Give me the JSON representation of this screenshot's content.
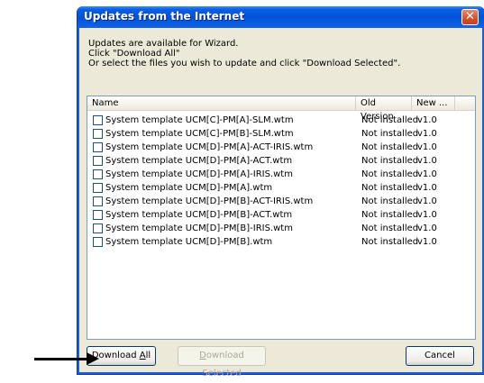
{
  "window": {
    "title": "Updates from the Internet",
    "close_glyph": "✕"
  },
  "instructions": {
    "line1": "Updates are available for Wizard.",
    "line2": "Click \"Download All\"",
    "line3": "Or select the files you wish to update and click \"Download Selected\"."
  },
  "list": {
    "columns": [
      "Name",
      "Old Version",
      "New ..."
    ],
    "rows": [
      {
        "name": "System template UCM[C]-PM[A]-SLM.wtm",
        "old": "Not installed",
        "new": "v1.0",
        "checked": false
      },
      {
        "name": "System template UCM[C]-PM[B]-SLM.wtm",
        "old": "Not installed",
        "new": "v1.0",
        "checked": false
      },
      {
        "name": "System template UCM[D]-PM[A]-ACT-IRIS.wtm",
        "old": "Not installed",
        "new": "v1.0",
        "checked": false
      },
      {
        "name": "System template UCM[D]-PM[A]-ACT.wtm",
        "old": "Not installed",
        "new": "v1.0",
        "checked": false
      },
      {
        "name": "System template UCM[D]-PM[A]-IRIS.wtm",
        "old": "Not installed",
        "new": "v1.0",
        "checked": false
      },
      {
        "name": "System template UCM[D]-PM[A].wtm",
        "old": "Not installed",
        "new": "v1.0",
        "checked": false
      },
      {
        "name": "System template UCM[D]-PM[B]-ACT-IRIS.wtm",
        "old": "Not installed",
        "new": "v1.0",
        "checked": false
      },
      {
        "name": "System template UCM[D]-PM[B]-ACT.wtm",
        "old": "Not installed",
        "new": "v1.0",
        "checked": false
      },
      {
        "name": "System template UCM[D]-PM[B]-IRIS.wtm",
        "old": "Not installed",
        "new": "v1.0",
        "checked": false
      },
      {
        "name": "System template UCM[D]-PM[B].wtm",
        "old": "Not installed",
        "new": "v1.0",
        "checked": false
      }
    ]
  },
  "buttons": {
    "download_all_pre": "Download ",
    "download_all_key": "A",
    "download_all_post": "ll",
    "download_selected_pre": "",
    "download_selected_key": "D",
    "download_selected_post": "ownload Selected",
    "cancel": "Cancel"
  },
  "colors": {
    "titlebar": "#0452d6",
    "dialog_bg": "#ece9d8",
    "close_button": "#d3502a",
    "annotation_arrow": "#000000"
  },
  "icons": {
    "close": "close-icon",
    "checkbox": "checkbox-icon",
    "annotation": "arrow-right-icon"
  }
}
